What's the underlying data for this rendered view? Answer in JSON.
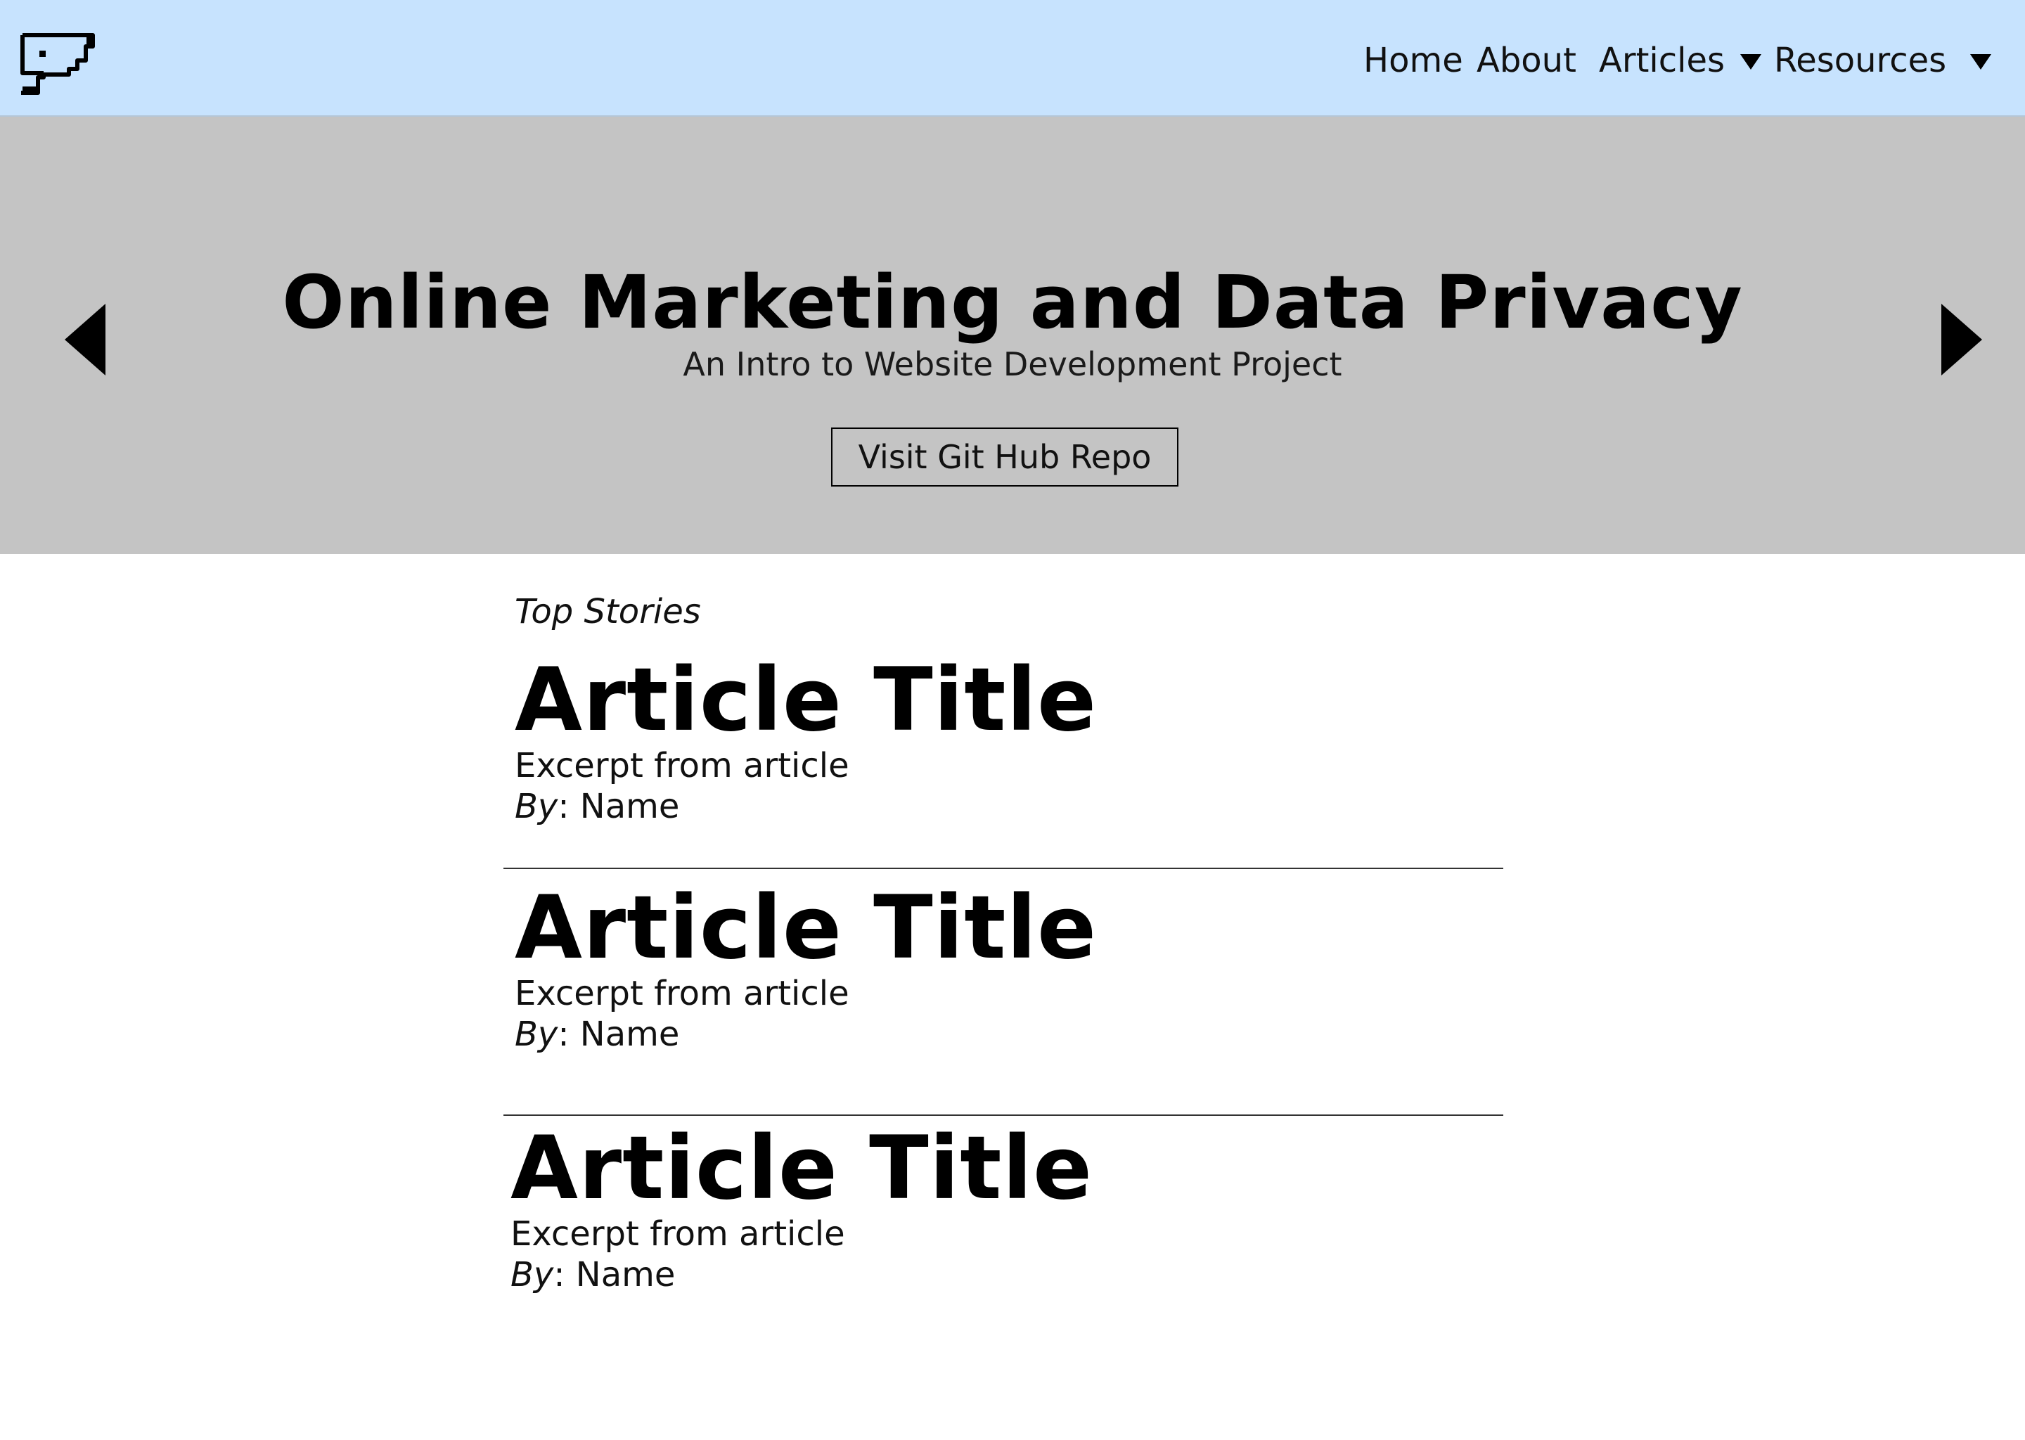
{
  "nav": {
    "logo_icon": "security-camera-icon",
    "items": [
      {
        "label": "Home",
        "has_dropdown": false
      },
      {
        "label": "About",
        "has_dropdown": false
      },
      {
        "label": "Articles",
        "has_dropdown": true
      },
      {
        "label": "Resources",
        "has_dropdown": true
      }
    ],
    "background_color": "#c7e3fe"
  },
  "hero": {
    "title": "Online Marketing and Data Privacy",
    "subtitle": "An Intro to Website Development Project",
    "button_label": "Visit Git Hub Repo",
    "prev_icon": "triangle-left-icon",
    "next_icon": "triangle-right-icon",
    "background_color": "#c4c4c4"
  },
  "stories": {
    "section_label": "Top Stories",
    "articles": [
      {
        "title": "Article Title",
        "excerpt": "Excerpt from article",
        "byline_label": "By",
        "byline_sep": ": ",
        "author": "Name"
      },
      {
        "title": "Article Title",
        "excerpt": "Excerpt from article",
        "byline_label": "By",
        "byline_sep": ": ",
        "author": "Name"
      },
      {
        "title": "Article Title",
        "excerpt": "Excerpt from article",
        "byline_label": "By",
        "byline_sep": ": ",
        "author": "Name"
      }
    ]
  }
}
